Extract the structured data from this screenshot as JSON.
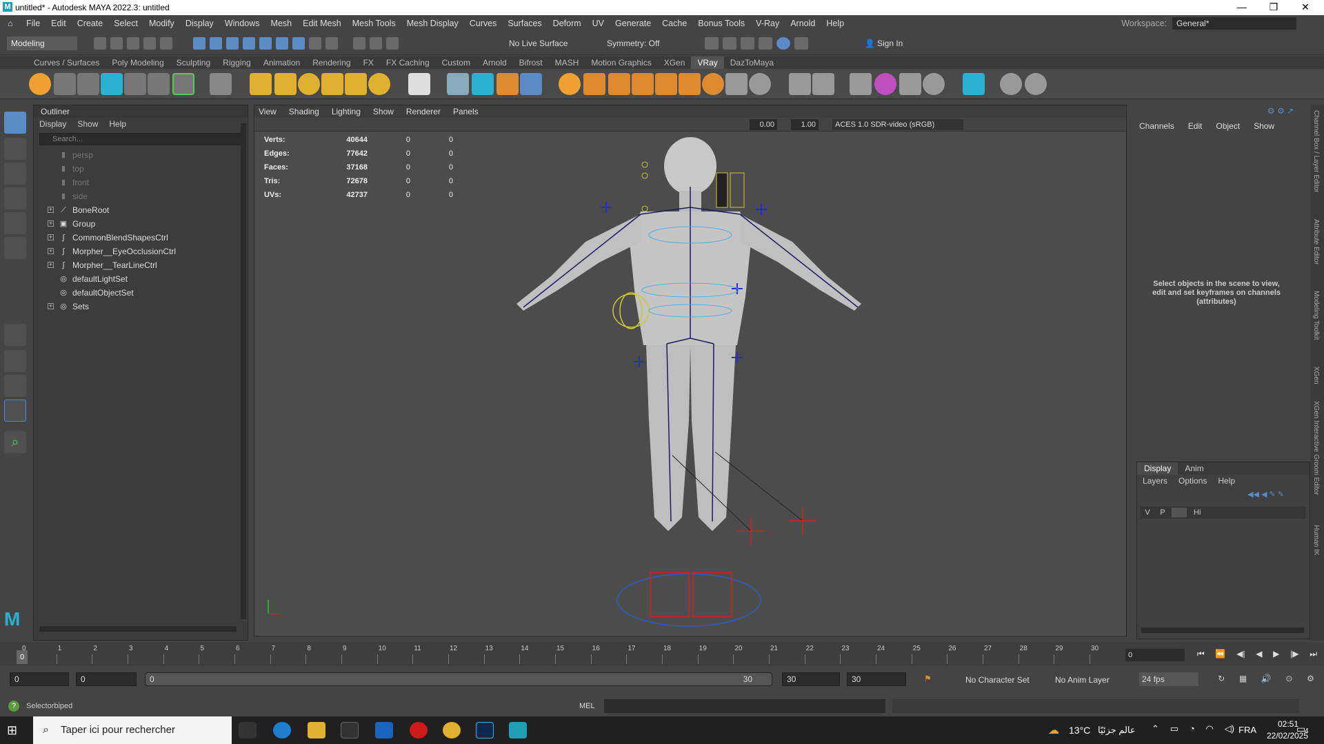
{
  "window": {
    "title": "untitled* - Autodesk MAYA 2022.3: untitled",
    "logo": "M",
    "minimize": "—",
    "restore": "❐",
    "close": "✕"
  },
  "menubar": {
    "items": [
      "File",
      "Edit",
      "Create",
      "Select",
      "Modify",
      "Display",
      "Windows",
      "Mesh",
      "Edit Mesh",
      "Mesh Tools",
      "Mesh Display",
      "Curves",
      "Surfaces",
      "Deform",
      "UV",
      "Generate",
      "Cache",
      "Bonus Tools",
      "V-Ray",
      "Arnold",
      "Help"
    ],
    "workspace_label": "Workspace:",
    "workspace_value": "General*"
  },
  "statusline": {
    "mode": "Modeling",
    "live_surface": "No Live Surface",
    "symmetry": "Symmetry: Off",
    "sign_in": "Sign In"
  },
  "shelf": {
    "tabs": [
      "Curves / Surfaces",
      "Poly Modeling",
      "Sculpting",
      "Rigging",
      "Animation",
      "Rendering",
      "FX",
      "FX Caching",
      "Custom",
      "Arnold",
      "Bifrost",
      "MASH",
      "Motion Graphics",
      "XGen",
      "VRay",
      "DazToMaya"
    ],
    "active_tab": "VRay"
  },
  "outliner": {
    "title": "Outliner",
    "menu": [
      "Display",
      "Show",
      "Help"
    ],
    "search_placeholder": "Search...",
    "items": [
      {
        "label": "persp",
        "icon": "camera-icon",
        "expandable": false,
        "dim": true
      },
      {
        "label": "top",
        "icon": "camera-icon",
        "expandable": false,
        "dim": true
      },
      {
        "label": "front",
        "icon": "camera-icon",
        "expandable": false,
        "dim": true
      },
      {
        "label": "side",
        "icon": "camera-icon",
        "expandable": false,
        "dim": true
      },
      {
        "label": "BoneRoot",
        "icon": "joint-icon",
        "expandable": true,
        "dim": false
      },
      {
        "label": "Group",
        "icon": "group-icon",
        "expandable": true,
        "dim": false
      },
      {
        "label": "CommonBlendShapesCtrl",
        "icon": "curve-icon",
        "expandable": true,
        "dim": false
      },
      {
        "label": "Morpher__EyeOcclusionCtrl",
        "icon": "curve-icon",
        "expandable": true,
        "dim": false
      },
      {
        "label": "Morpher__TearLineCtrl",
        "icon": "curve-icon",
        "expandable": true,
        "dim": false
      },
      {
        "label": "defaultLightSet",
        "icon": "set-icon",
        "expandable": false,
        "dim": false
      },
      {
        "label": "defaultObjectSet",
        "icon": "set-icon",
        "expandable": false,
        "dim": false
      },
      {
        "label": "Sets",
        "icon": "set-icon",
        "expandable": true,
        "dim": false
      }
    ]
  },
  "viewport": {
    "menu": [
      "View",
      "Shading",
      "Lighting",
      "Show",
      "Renderer",
      "Panels"
    ],
    "exposure": "0.00",
    "gamma": "1.00",
    "color_space": "ACES 1.0 SDR-video (sRGB)",
    "hud": [
      {
        "k": "Verts:",
        "v": "40644",
        "a": "0",
        "b": "0"
      },
      {
        "k": "Edges:",
        "v": "77642",
        "a": "0",
        "b": "0"
      },
      {
        "k": "Faces:",
        "v": "37168",
        "a": "0",
        "b": "0"
      },
      {
        "k": "Tris:",
        "v": "72678",
        "a": "0",
        "b": "0"
      },
      {
        "k": "UVs:",
        "v": "42737",
        "a": "0",
        "b": "0"
      }
    ]
  },
  "channelbox": {
    "menu": [
      "Channels",
      "Edit",
      "Object",
      "Show"
    ],
    "message": "Select objects in the scene to view, edit and set keyframes on channels (attributes)"
  },
  "layers": {
    "tabs": [
      "Display",
      "Anim"
    ],
    "menu": [
      "Layers",
      "Options",
      "Help"
    ],
    "cols": [
      "V",
      "P",
      "",
      "Hi"
    ]
  },
  "side_tabs": [
    "Channel Box / Layer Editor",
    "Attribute Editor",
    "Modeling Toolkit",
    "XGen",
    "XGen Interactive Groom Editor",
    "Human IK"
  ],
  "timeline": {
    "ticks": [
      "0",
      "1",
      "2",
      "3",
      "4",
      "5",
      "6",
      "7",
      "8",
      "9",
      "10",
      "11",
      "12",
      "13",
      "14",
      "15",
      "16",
      "17",
      "18",
      "19",
      "20",
      "21",
      "22",
      "23",
      "24",
      "25",
      "26",
      "27",
      "28",
      "29",
      "30"
    ],
    "current_frame": "0",
    "current_field": "0"
  },
  "range": {
    "start": "0",
    "inner_start": "0",
    "slider_start": "0",
    "slider_end": "30",
    "end": "30",
    "outer_end": "30",
    "character_set": "No Character Set",
    "anim_layer": "No Anim Layer",
    "fps": "24 fps"
  },
  "command": {
    "help_text": "Selectorbiped",
    "mel": "MEL"
  },
  "taskbar": {
    "search": "Taper ici pour rechercher",
    "weather": "13°C",
    "weather_text": "عالم جزئيًا",
    "lang": "FRA",
    "time": "02:51",
    "date": "22/02/2025",
    "notif": "4"
  }
}
